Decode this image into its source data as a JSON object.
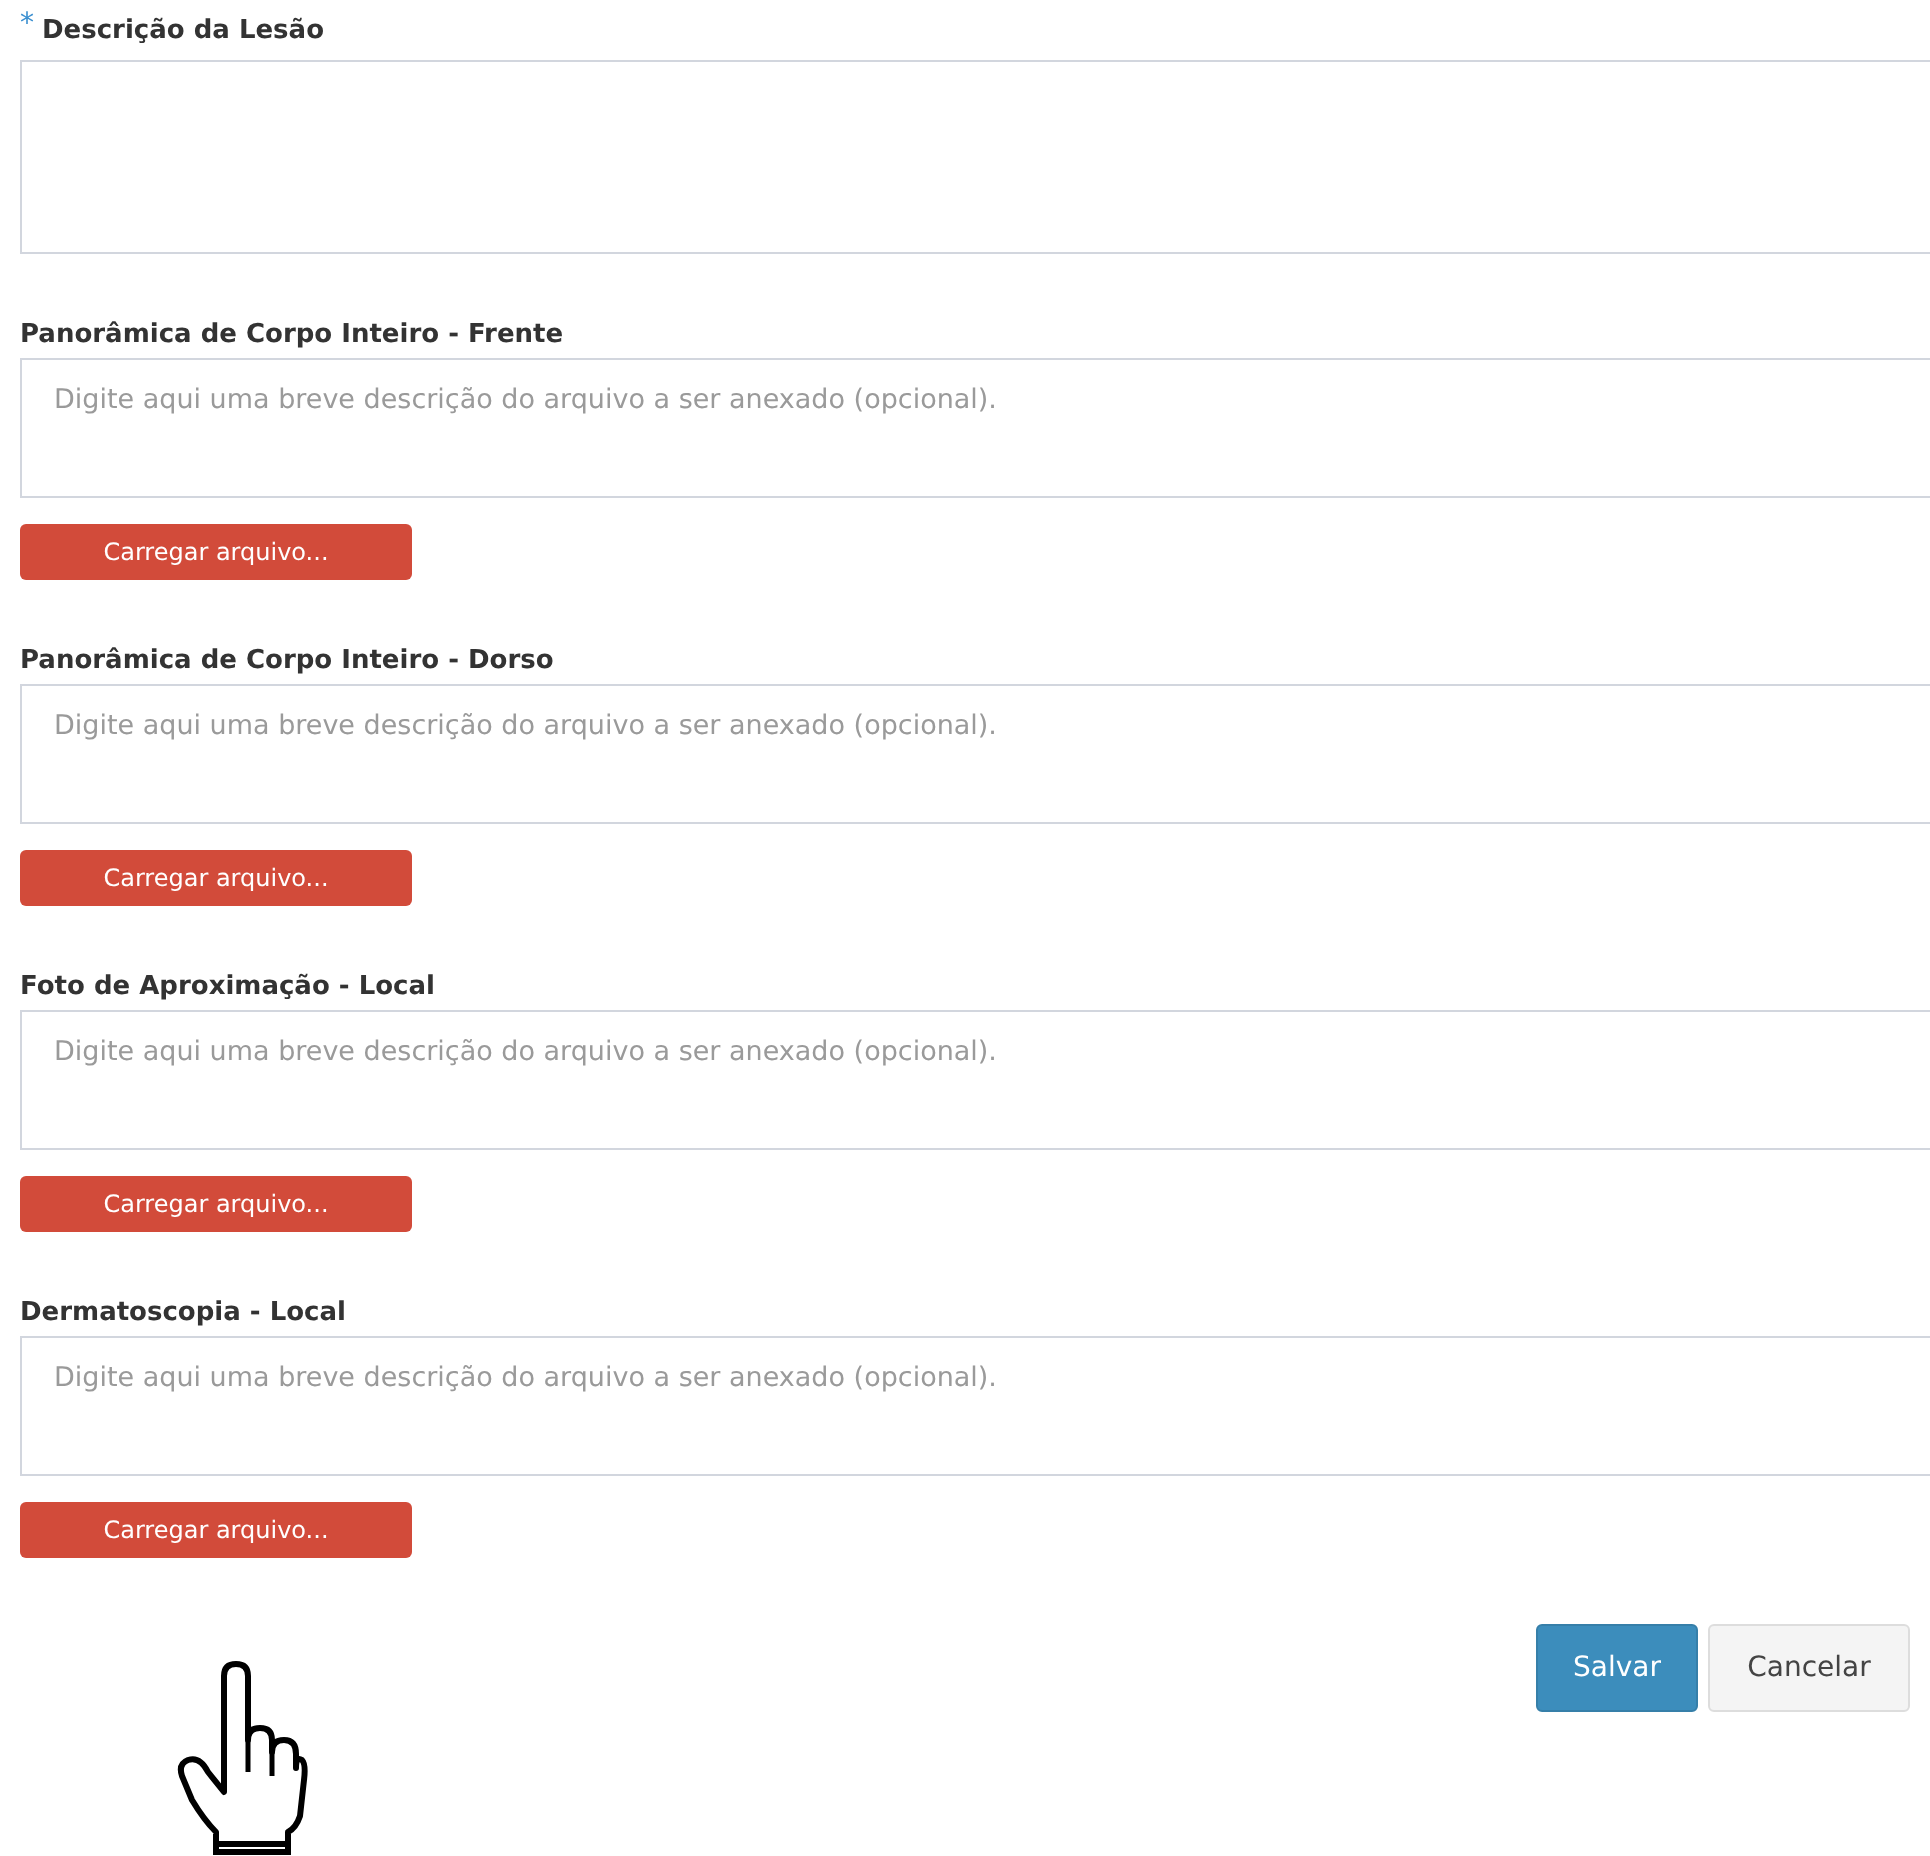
{
  "description": {
    "required_mark": "*",
    "label": "Descrição da Lesão"
  },
  "attachments": [
    {
      "label": "Panorâmica de Corpo Inteiro - Frente",
      "placeholder": "Digite aqui uma breve descrição do arquivo a ser anexado (opcional).",
      "button": "Carregar arquivo..."
    },
    {
      "label": "Panorâmica de Corpo Inteiro - Dorso",
      "placeholder": "Digite aqui uma breve descrição do arquivo a ser anexado (opcional).",
      "button": "Carregar arquivo..."
    },
    {
      "label": "Foto de Aproximação - Local",
      "placeholder": "Digite aqui uma breve descrição do arquivo a ser anexado (opcional).",
      "button": "Carregar arquivo..."
    },
    {
      "label": "Dermatoscopia - Local",
      "placeholder": "Digite aqui uma breve descrição do arquivo a ser anexado (opcional).",
      "button": "Carregar arquivo..."
    }
  ],
  "actions": {
    "save": "Salvar",
    "cancel": "Cancelar"
  }
}
